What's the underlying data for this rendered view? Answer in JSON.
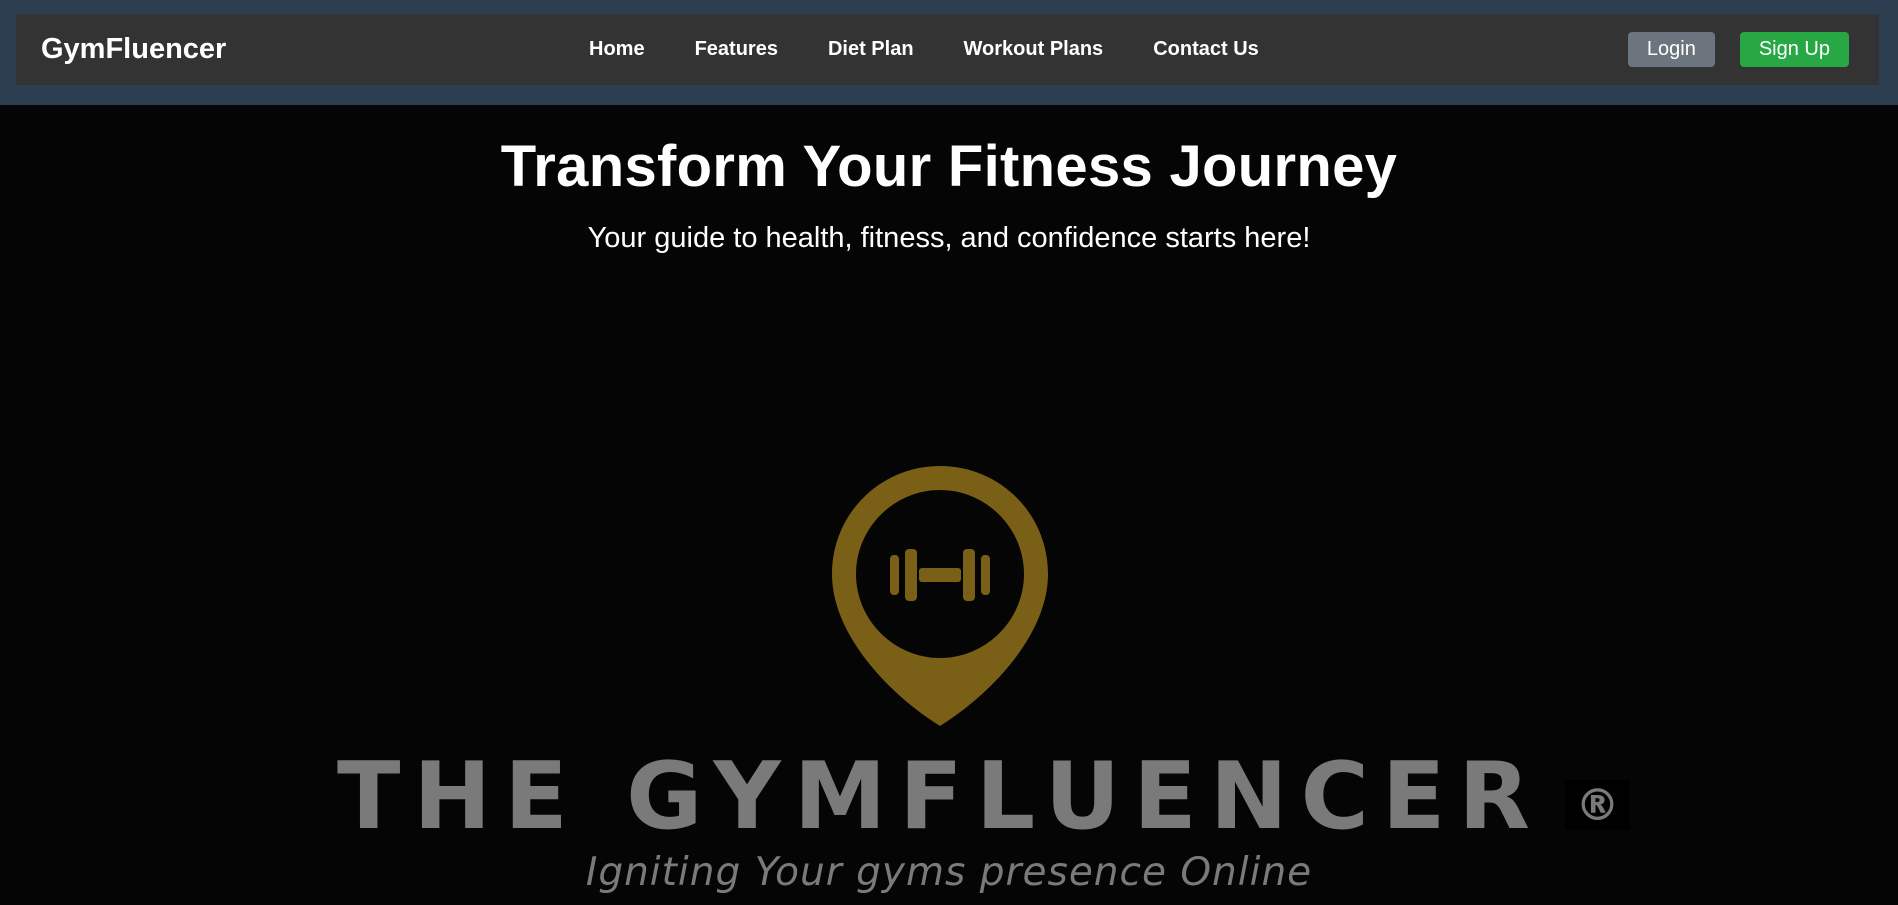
{
  "navbar": {
    "brand": "GymFluencer",
    "links": [
      "Home",
      "Features",
      "Diet Plan",
      "Workout Plans",
      "Contact Us"
    ],
    "login_label": "Login",
    "signup_label": "Sign Up"
  },
  "hero": {
    "title": "Transform Your Fitness Journey",
    "subtitle": "Your guide to health, fitness, and confidence starts here!"
  },
  "logo": {
    "wordmark": "THE GYMFLUENCER",
    "registered_mark": "®",
    "tagline": "Igniting Your gyms presence Online",
    "icon": "location-pin-dumbbell-icon",
    "accent_color": "#7a6016",
    "text_color": "#7a7a7a"
  },
  "colors": {
    "header_band": "#2c3e50",
    "navbar": "#333333",
    "login_button": "#6c757d",
    "signup_button": "#28a745",
    "hero_background": "#050505"
  }
}
